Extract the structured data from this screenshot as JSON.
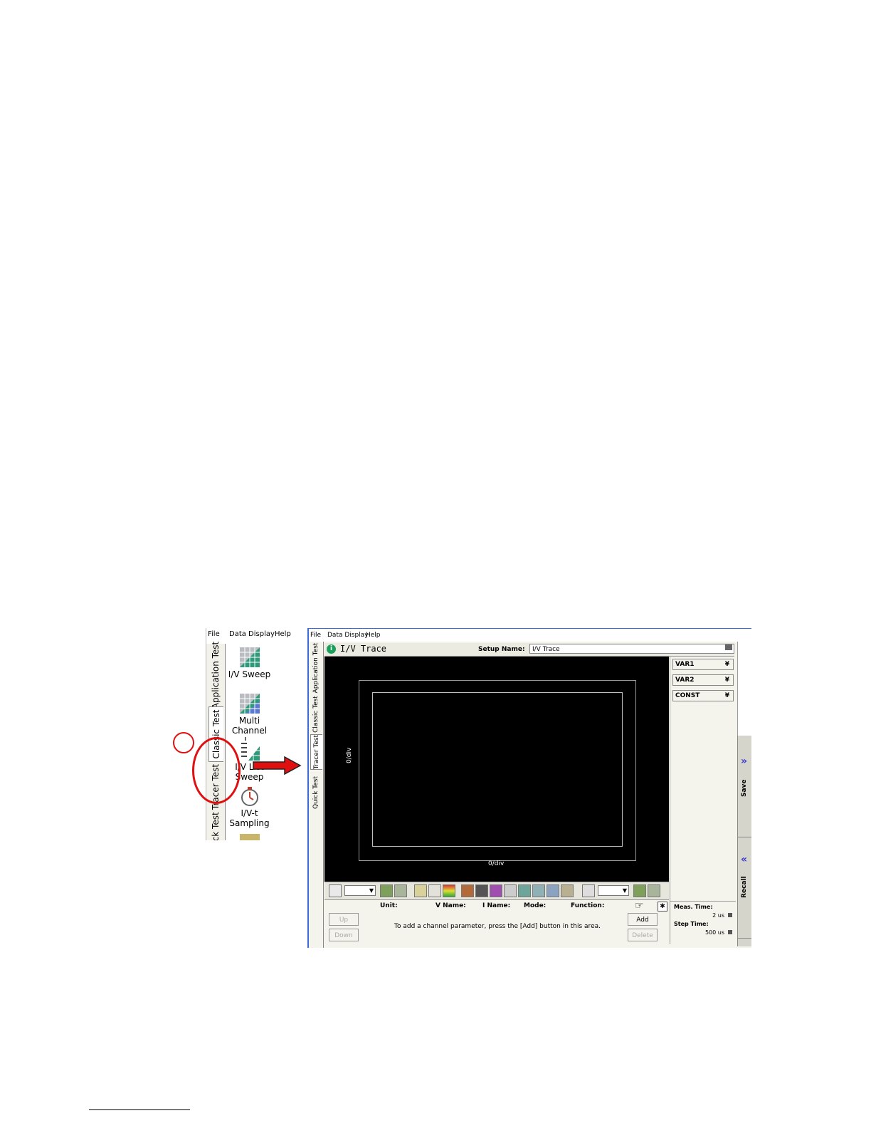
{
  "left_screenshot": {
    "menu": [
      "File",
      "Data Display",
      "Help"
    ],
    "tabs": [
      "Application Test",
      "Classic Test",
      "Tracer Test",
      "Quick Test"
    ],
    "icons": [
      {
        "label": "I/V Sweep",
        "icon": "grid-sweep-icon"
      },
      {
        "label": "Multi Channel I...",
        "icon": "multi-channel-icon"
      },
      {
        "label": "I/V List Sweep",
        "icon": "list-sweep-icon"
      },
      {
        "label": "I/V-t Sampling",
        "icon": "stopwatch-icon"
      }
    ]
  },
  "main_screenshot": {
    "menu": [
      "File",
      "Data Display",
      "Help"
    ],
    "tabs": [
      "Application Test",
      "Classic Test",
      "Tracer Test",
      "Quick Test"
    ],
    "title": "I/V Trace",
    "setup_label": "Setup Name:",
    "setup_value": "I/V Trace",
    "graph": {
      "y_label": "0/div",
      "x_label": "0/div"
    },
    "channel_columns": [
      "Unit:",
      "V Name:",
      "I Name:",
      "Mode:",
      "Function:"
    ],
    "channel_message": "To add a channel parameter, press the [Add] button in this area.",
    "buttons": {
      "up": "Up",
      "down": "Down",
      "add": "Add",
      "delete": "Delete"
    },
    "variables": [
      "VAR1",
      "VAR2",
      "CONST"
    ],
    "meas_time_label": "Meas. Time:",
    "meas_time_value": "2 us",
    "step_time_label": "Step Time:",
    "step_time_value": "500 us",
    "side": {
      "save": "Save",
      "recall": "Recall"
    }
  },
  "colors": {
    "annotation": "#e01010",
    "graph_bg": "#000000",
    "panel_bg": "#f4f3ec"
  }
}
